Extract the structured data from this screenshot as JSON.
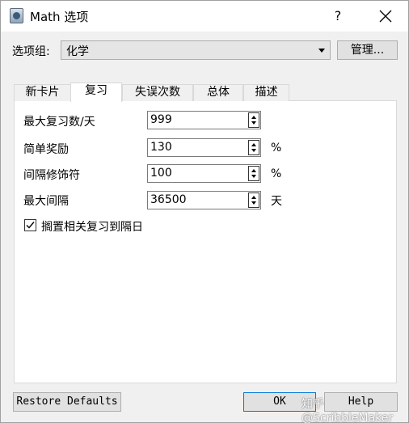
{
  "window": {
    "title": "Math 选项",
    "help_glyph": "?",
    "close_label": "close"
  },
  "option_group": {
    "label": "选项组:",
    "selected": "化学",
    "manage_label": "管理..."
  },
  "tabs": [
    {
      "label": "新卡片",
      "active": false
    },
    {
      "label": "复习",
      "active": true
    },
    {
      "label": "失误次数",
      "active": false
    },
    {
      "label": "总体",
      "active": false
    },
    {
      "label": "描述",
      "active": false
    }
  ],
  "review": {
    "max_reviews": {
      "label": "最大复习数/天",
      "value": "999",
      "unit": ""
    },
    "easy_bonus": {
      "label": "简单奖励",
      "value": "130",
      "unit": "%"
    },
    "interval_modifier": {
      "label": "间隔修饰符",
      "value": "100",
      "unit": "%"
    },
    "max_interval": {
      "label": "最大间隔",
      "value": "36500",
      "unit": "天"
    },
    "bury_related": {
      "label": "搁置相关复习到隔日",
      "checked": true
    }
  },
  "buttons": {
    "restore_defaults": "Restore Defaults",
    "ok": "OK",
    "help": "Help"
  },
  "watermark": "知乎 @ScribbleMaker",
  "icons": {
    "app": "app-icon",
    "close": "close-icon",
    "dropdown": "chevron-down-icon",
    "check": "check-icon"
  }
}
